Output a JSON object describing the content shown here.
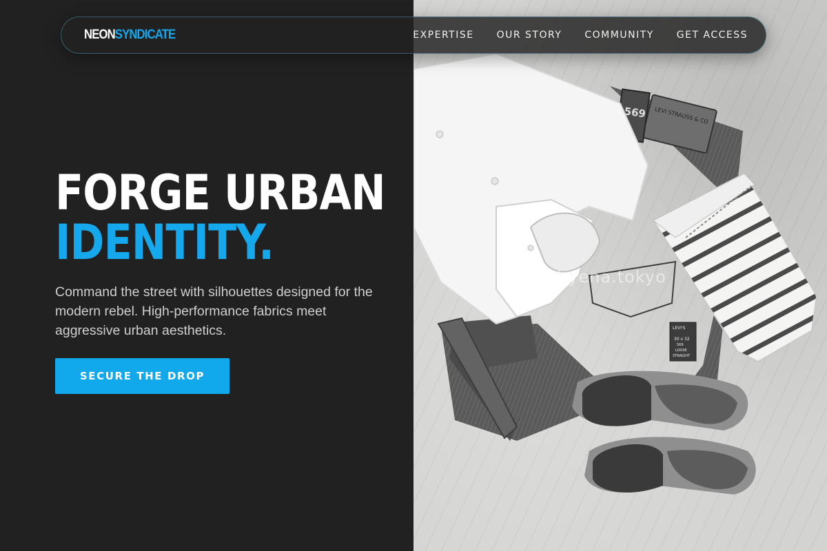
{
  "brand": {
    "part1": "NEON",
    "part2": "SYNDICATE"
  },
  "nav": {
    "links": [
      {
        "label": "EXPERTISE"
      },
      {
        "label": "OUR STORY"
      },
      {
        "label": "COMMUNITY"
      },
      {
        "label": "GET ACCESS"
      }
    ]
  },
  "hero": {
    "title_line1": "FORGE URBAN",
    "title_line2": "IDENTITY.",
    "description": "Command the street with silhouettes designed for the modern rebel. High-performance fabrics meet aggressive urban aesthetics.",
    "cta_label": "SECURE THE DROP"
  },
  "photo": {
    "watermark": "hyena.tokyo",
    "labels": {
      "tag_number": "569",
      "patch_text": "LEVI STRAUSS & CO",
      "pocket_brand": "LEVI'S",
      "size_line1": "30 x 32",
      "size_line2": "569",
      "size_line3": "LOOSE",
      "size_line4": "STRAIGHT"
    }
  },
  "colors": {
    "background": "#212121",
    "accent": "#16a8ec",
    "text_primary": "#ffffff",
    "text_secondary": "#cfcfcf"
  }
}
